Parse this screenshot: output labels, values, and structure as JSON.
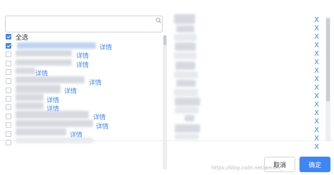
{
  "search": {
    "placeholder": ""
  },
  "select_all": {
    "label": "全选",
    "checked": true
  },
  "rows": [
    {
      "checked": true,
      "link": "详情"
    },
    {
      "checked": false,
      "link": "详情"
    },
    {
      "checked": false,
      "link": "详情"
    },
    {
      "checked": false,
      "link": "详情"
    },
    {
      "checked": false,
      "link": "详情"
    },
    {
      "checked": false,
      "link": "详情"
    },
    {
      "checked": false,
      "link": "详情"
    },
    {
      "checked": false,
      "link": "详情"
    },
    {
      "checked": false,
      "link": "详情"
    },
    {
      "checked": false,
      "link": "详情"
    },
    {
      "checked": false,
      "link": "详情"
    },
    {
      "checked": false,
      "link": ""
    }
  ],
  "selected_remove_marks": [
    "X",
    "X",
    "X",
    "X",
    "X",
    "X",
    "X",
    "X",
    "X",
    "X",
    "X",
    "X",
    "X",
    "X",
    "X",
    "X"
  ],
  "footer": {
    "cancel_label": "取消",
    "ok_label": "确定"
  },
  "watermark": "https://blog.csdn.net/weixin_"
}
